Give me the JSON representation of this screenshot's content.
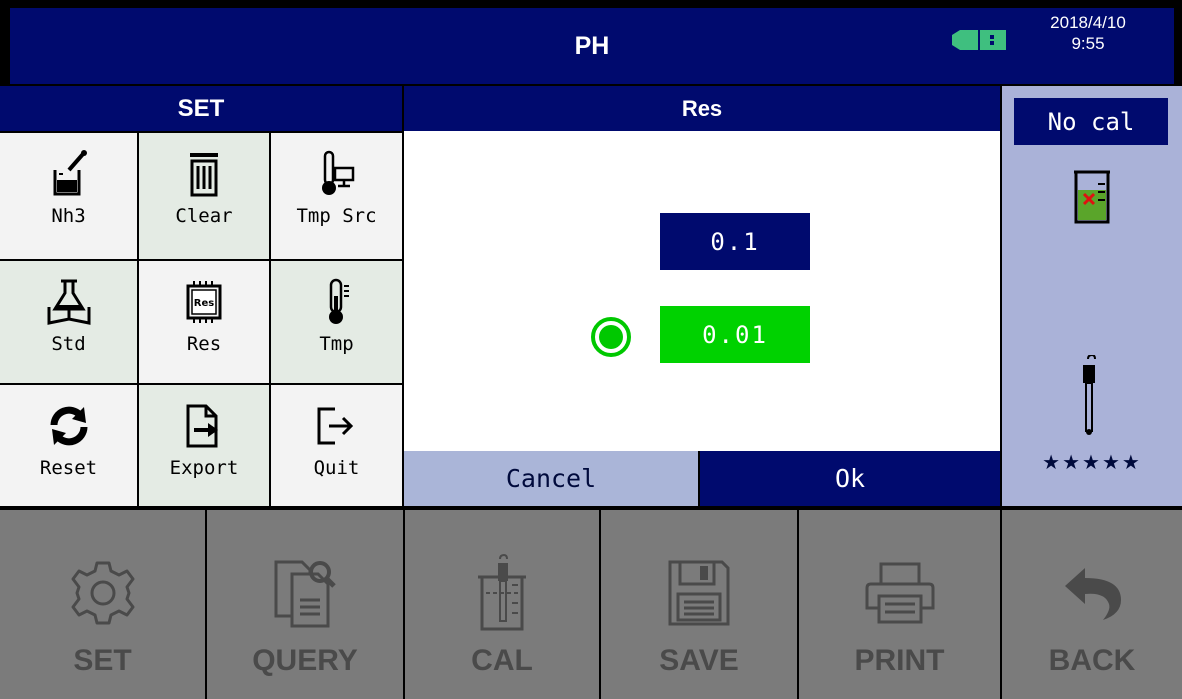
{
  "header": {
    "title": "PH",
    "date": "2018/4/10",
    "time": "9:55",
    "usb_icon": "usb-connected-icon",
    "accent": "#000a6e"
  },
  "set_panel": {
    "title": "SET",
    "items": [
      {
        "label": "Nh3",
        "icon": "beaker-dropper-icon"
      },
      {
        "label": "Clear",
        "icon": "trash-icon"
      },
      {
        "label": "Tmp Src",
        "icon": "thermometer-monitor-icon"
      },
      {
        "label": "Std",
        "icon": "flask-book-icon"
      },
      {
        "label": "Res",
        "icon": "chip-res-icon"
      },
      {
        "label": "Tmp",
        "icon": "thermometer-icon"
      },
      {
        "label": "Reset",
        "icon": "refresh-icon"
      },
      {
        "label": "Export",
        "icon": "file-export-icon"
      },
      {
        "label": "Quit",
        "icon": "exit-icon"
      }
    ]
  },
  "res_dialog": {
    "title": "Res",
    "options": [
      {
        "value": "0.1",
        "selected": false
      },
      {
        "value": "0.01",
        "selected": true
      }
    ],
    "cancel_label": "Cancel",
    "ok_label": "Ok",
    "selected_color": "#00d200"
  },
  "status_panel": {
    "cal_status": "No cal",
    "stars": "★★★★★",
    "beaker_icon": "beaker-error-icon",
    "electrode_icon": "electrode-icon"
  },
  "bottom_bar": {
    "buttons": [
      {
        "label": "SET",
        "icon": "gear-icon"
      },
      {
        "label": "QUERY",
        "icon": "query-documents-icon"
      },
      {
        "label": "CAL",
        "icon": "calibrate-beaker-icon"
      },
      {
        "label": "SAVE",
        "icon": "floppy-disk-icon"
      },
      {
        "label": "PRINT",
        "icon": "printer-icon"
      },
      {
        "label": "BACK",
        "icon": "back-arrow-icon"
      }
    ]
  }
}
